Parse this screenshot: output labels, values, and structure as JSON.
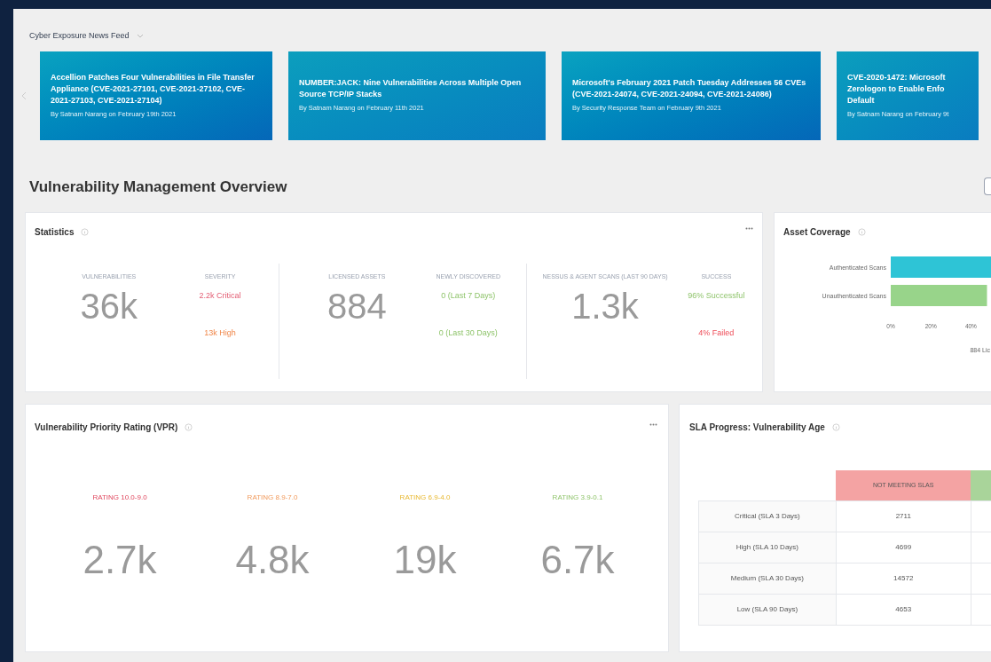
{
  "news_feed": {
    "title": "Cyber Exposure News Feed",
    "articles": [
      {
        "headline": "Accellion Patches Four Vulnerabilities in File Transfer Appliance (CVE-2021-27101, CVE-2021-27102, CVE-2021-27103, CVE-2021-27104)",
        "byline": "By Satnam Narang on February 19th 2021"
      },
      {
        "headline": "NUMBER:JACK: Nine Vulnerabilities Across Multiple Open Source TCP/IP Stacks",
        "byline": "By Satnam Narang on February 11th 2021"
      },
      {
        "headline": "Microsoft's February 2021 Patch Tuesday Addresses 56 CVEs (CVE-2021-24074, CVE-2021-24094, CVE-2021-24086)",
        "byline": "By Security Response Team on February 9th 2021"
      },
      {
        "headline": "CVE-2020-1472: Microsoft Zerologon to Enable Enfo Default",
        "byline": "By Satnam Narang on February 9t"
      }
    ]
  },
  "overview": {
    "title": "Vulnerability Management Overview"
  },
  "statistics": {
    "title": "Statistics",
    "columns": [
      {
        "kind": "big",
        "label": "VULNERABILITIES",
        "value": "36k"
      },
      {
        "kind": "split",
        "label": "SEVERITY",
        "lines": [
          {
            "text": "2.2k Critical",
            "kind": "critical"
          },
          {
            "text": "13k High",
            "kind": "high"
          }
        ]
      },
      {
        "kind": "big",
        "label": "LICENSED ASSETS",
        "value": "884"
      },
      {
        "kind": "split",
        "label": "NEWLY DISCOVERED",
        "lines": [
          {
            "text": "0 (Last 7 Days)",
            "kind": "good"
          },
          {
            "text": "0 (Last 30 Days)",
            "kind": "good"
          }
        ]
      },
      {
        "kind": "big",
        "label": "NESSUS & AGENT SCANS (LAST 90 DAYS)",
        "value": "1.3k"
      },
      {
        "kind": "split",
        "label": "SUCCESS",
        "lines": [
          {
            "text": "96% Successful",
            "kind": "good"
          },
          {
            "text": "4% Failed",
            "kind": "bad"
          }
        ]
      }
    ]
  },
  "asset_coverage": {
    "title": "Asset Coverage",
    "chart_data": {
      "type": "bar",
      "orientation": "horizontal",
      "categories": [
        "Authenticated Scans",
        "Unauthenticated Scans"
      ],
      "values": [
        50,
        48
      ],
      "xlim": [
        0,
        50
      ],
      "xticks": [
        {
          "value": 0,
          "label": "0%"
        },
        {
          "value": 20,
          "label": "20%"
        },
        {
          "value": 40,
          "label": "40%"
        }
      ],
      "xlabel": "884 Lic"
    }
  },
  "vpr": {
    "title": "Vulnerability Priority Rating (VPR)",
    "ratings": [
      {
        "label": "RATING 10.0-9.0",
        "value": "2.7k",
        "kind": "critical"
      },
      {
        "label": "RATING 8.9-7.0",
        "value": "4.8k",
        "kind": "high"
      },
      {
        "label": "RATING 6.9-4.0",
        "value": "19k",
        "kind": "medium"
      },
      {
        "label": "RATING 3.9-0.1",
        "value": "6.7k",
        "kind": "low"
      }
    ]
  },
  "sla": {
    "title": "SLA Progress: Vulnerability Age",
    "columns": [
      {
        "label": "NOT MEETING SLAS",
        "color": "#f4a3a3"
      },
      {
        "color": "#a9d49a"
      }
    ],
    "rows": [
      {
        "label": "Critical (SLA 3 Days)",
        "value": "2711"
      },
      {
        "label": "High (SLA 10 Days)",
        "value": "4699"
      },
      {
        "label": "Medium (SLA 30 Days)",
        "value": "14572"
      },
      {
        "label": "Low (SLA 90 Days)",
        "value": "4653"
      }
    ]
  }
}
